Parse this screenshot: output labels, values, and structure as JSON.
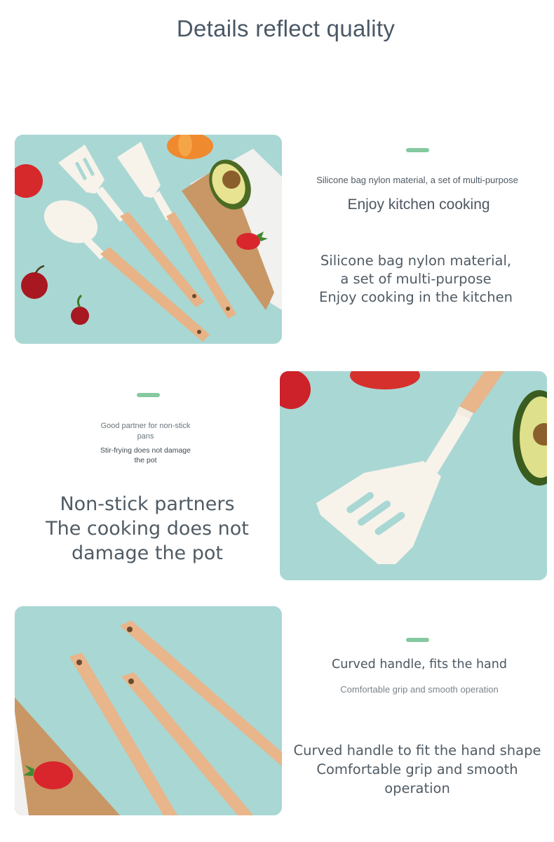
{
  "header": {
    "title": "Details reflect quality"
  },
  "section1": {
    "small": "Silicone bag nylon material, a set of multi-purpose",
    "headline": "Enjoy kitchen cooking",
    "body": [
      "Silicone bag nylon material,",
      "a set of multi-purpose",
      "Enjoy cooking in the kitchen"
    ]
  },
  "section2": {
    "tiny1": [
      "Good partner for non-stick",
      "pans"
    ],
    "tiny2": [
      "Stir-frying does not damage",
      "the pot"
    ],
    "body": [
      "Non-stick partners",
      "The cooking does not",
      "damage the pot"
    ]
  },
  "section3": {
    "headline": "Curved handle, fits the hand",
    "small": "Comfortable grip and smooth operation",
    "body": [
      "Curved handle to fit the hand shape",
      "Comfortable grip and smooth operation"
    ]
  },
  "colors": {
    "accent": "#86c9a0",
    "background_photo": "#a8d6d3",
    "wood": "#e9b58a"
  }
}
